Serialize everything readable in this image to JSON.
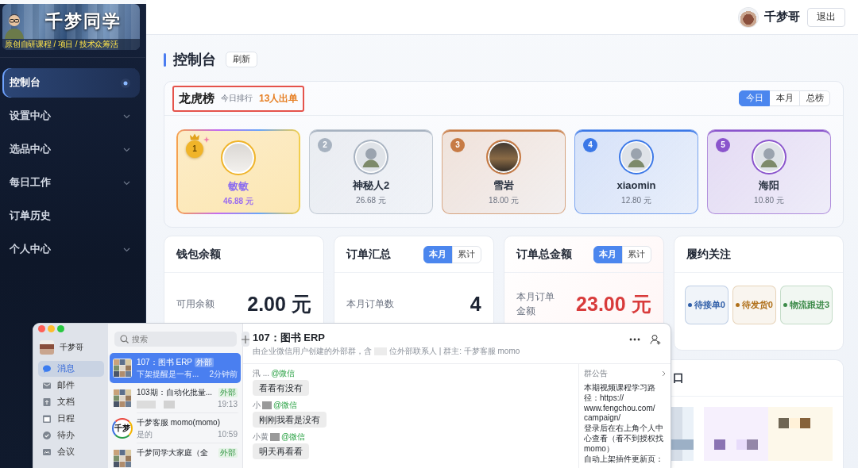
{
  "sidebar": {
    "logo": {
      "title": "千梦同学",
      "tagline": "原创自研课程 / 项目 / 技术众筹活"
    },
    "items": [
      {
        "label": "控制台",
        "selected": true,
        "expandable": false
      },
      {
        "label": "设置中心",
        "selected": false,
        "expandable": true
      },
      {
        "label": "选品中心",
        "selected": false,
        "expandable": true
      },
      {
        "label": "每日工作",
        "selected": false,
        "expandable": true
      },
      {
        "label": "订单历史",
        "selected": false,
        "expandable": false
      },
      {
        "label": "个人中心",
        "selected": false,
        "expandable": true
      }
    ]
  },
  "header": {
    "user_name": "千梦哥",
    "logout": "退出"
  },
  "page": {
    "title": "控制台",
    "refresh": "刷新"
  },
  "leaderboard": {
    "title": "龙虎榜",
    "subtitle": "今日排行",
    "count": "13人出单",
    "highlighted": true,
    "tabs": [
      {
        "label": "今日",
        "selected": true
      },
      {
        "label": "本月",
        "selected": false
      },
      {
        "label": "总榜",
        "selected": false
      }
    ],
    "entries": [
      {
        "kind": "champion",
        "rank": "1",
        "avatar": {
          "kind": "portrait"
        },
        "name": "敏敏",
        "amount": "46.88 元",
        "color": "#f0b429"
      },
      {
        "kind": "standard",
        "rank": "2",
        "avatar": {
          "kind": "cartoon"
        },
        "name": "神秘人2",
        "amount": "26.68 元",
        "color": "#a7b2c0"
      },
      {
        "kind": "standard",
        "rank": "3",
        "avatar": {
          "kind": "landscape"
        },
        "name": "雪岩",
        "amount": "18.00 元",
        "color": "#c77b45"
      },
      {
        "kind": "standard",
        "rank": "4",
        "avatar": {
          "kind": "cartoon"
        },
        "name": "xiaomin",
        "amount": "12.80 元",
        "color": "#3b78e7"
      },
      {
        "kind": "standard",
        "rank": "5",
        "avatar": {
          "kind": "cartoon"
        },
        "name": "海阳",
        "amount": "10.80 元",
        "color": "#8a55cc"
      }
    ]
  },
  "stats": [
    {
      "kind": "balance",
      "title": "钱包余额",
      "label": "可用余额",
      "value": "2.00 元"
    },
    {
      "kind": "count",
      "title": "订单汇总",
      "tabs": [
        {
          "label": "本月",
          "selected": true
        },
        {
          "label": "累计",
          "selected": false
        }
      ],
      "label": "本月订单数",
      "value": "4"
    },
    {
      "kind": "amount",
      "title": "订单总金额",
      "tabs": [
        {
          "label": "本月",
          "selected": true
        },
        {
          "label": "累计",
          "selected": false
        }
      ],
      "label": "本月订单金额",
      "value": "23.00 元"
    },
    {
      "kind": "chips",
      "title": "履约关注",
      "chips": [
        {
          "label": "待接单0",
          "color": "#2f5ea8"
        },
        {
          "label": "待发货0",
          "color": "#b0701a"
        },
        {
          "label": "物流跟进3",
          "color": "#3d8b4a"
        }
      ]
    }
  ],
  "lower_card": {
    "title": "口"
  },
  "chat_window": {
    "user_name": "千梦哥",
    "nav": [
      {
        "label": "消息",
        "selected": true
      },
      {
        "label": "邮件",
        "selected": false
      },
      {
        "label": "文档",
        "selected": false
      },
      {
        "label": "日程",
        "selected": false
      },
      {
        "label": "待办",
        "selected": false
      },
      {
        "label": "会议",
        "selected": false
      }
    ],
    "search": {
      "placeholder": "搜索"
    },
    "conversations": [
      {
        "avatar": {
          "kind": "group"
        },
        "title": "107：图书 ERP",
        "tag": "外部",
        "preview": "下架提醒是一有...",
        "time": "2分钟前",
        "selected": true
      },
      {
        "avatar": {
          "kind": "group"
        },
        "title": "103期：自动化批量...",
        "tag": "外部",
        "preview_redacted": true,
        "time": "19:13",
        "selected": false
      },
      {
        "avatar": {
          "kind": "logo",
          "text": "千梦"
        },
        "title": "千梦客服 momo(momo)",
        "preview": "是的",
        "time": "10:59",
        "selected": false
      },
      {
        "avatar": {
          "kind": "group"
        },
        "title": "千梦同学大家庭（全",
        "tag": "外部",
        "selected": false
      }
    ],
    "chat": {
      "title": "107：图书 ERP",
      "info_before": "由企业微信用户创建的外部群，含",
      "info_redacted": true,
      "info_after": "位外部联系人 | 群主: 千梦客服 momo",
      "messages": [
        {
          "sender": "汛 ...",
          "redacted": false,
          "source": "@微信",
          "text": "看看有没有"
        },
        {
          "sender": "小",
          "redacted": true,
          "source": "@微信",
          "text": "刚刚我看是没有"
        },
        {
          "sender": "小黄",
          "redacted": true,
          "source": "@微信",
          "text": "明天再看看"
        }
      ],
      "notice": {
        "title": "群公告",
        "paragraphs": [
          "本期视频课程学习路径：https://www.fengchou.com/campaign/",
          "登录后在右上角个人中心查看（看不到授权找 momo）",
          "自动上架插件更新页："
        ]
      }
    }
  }
}
